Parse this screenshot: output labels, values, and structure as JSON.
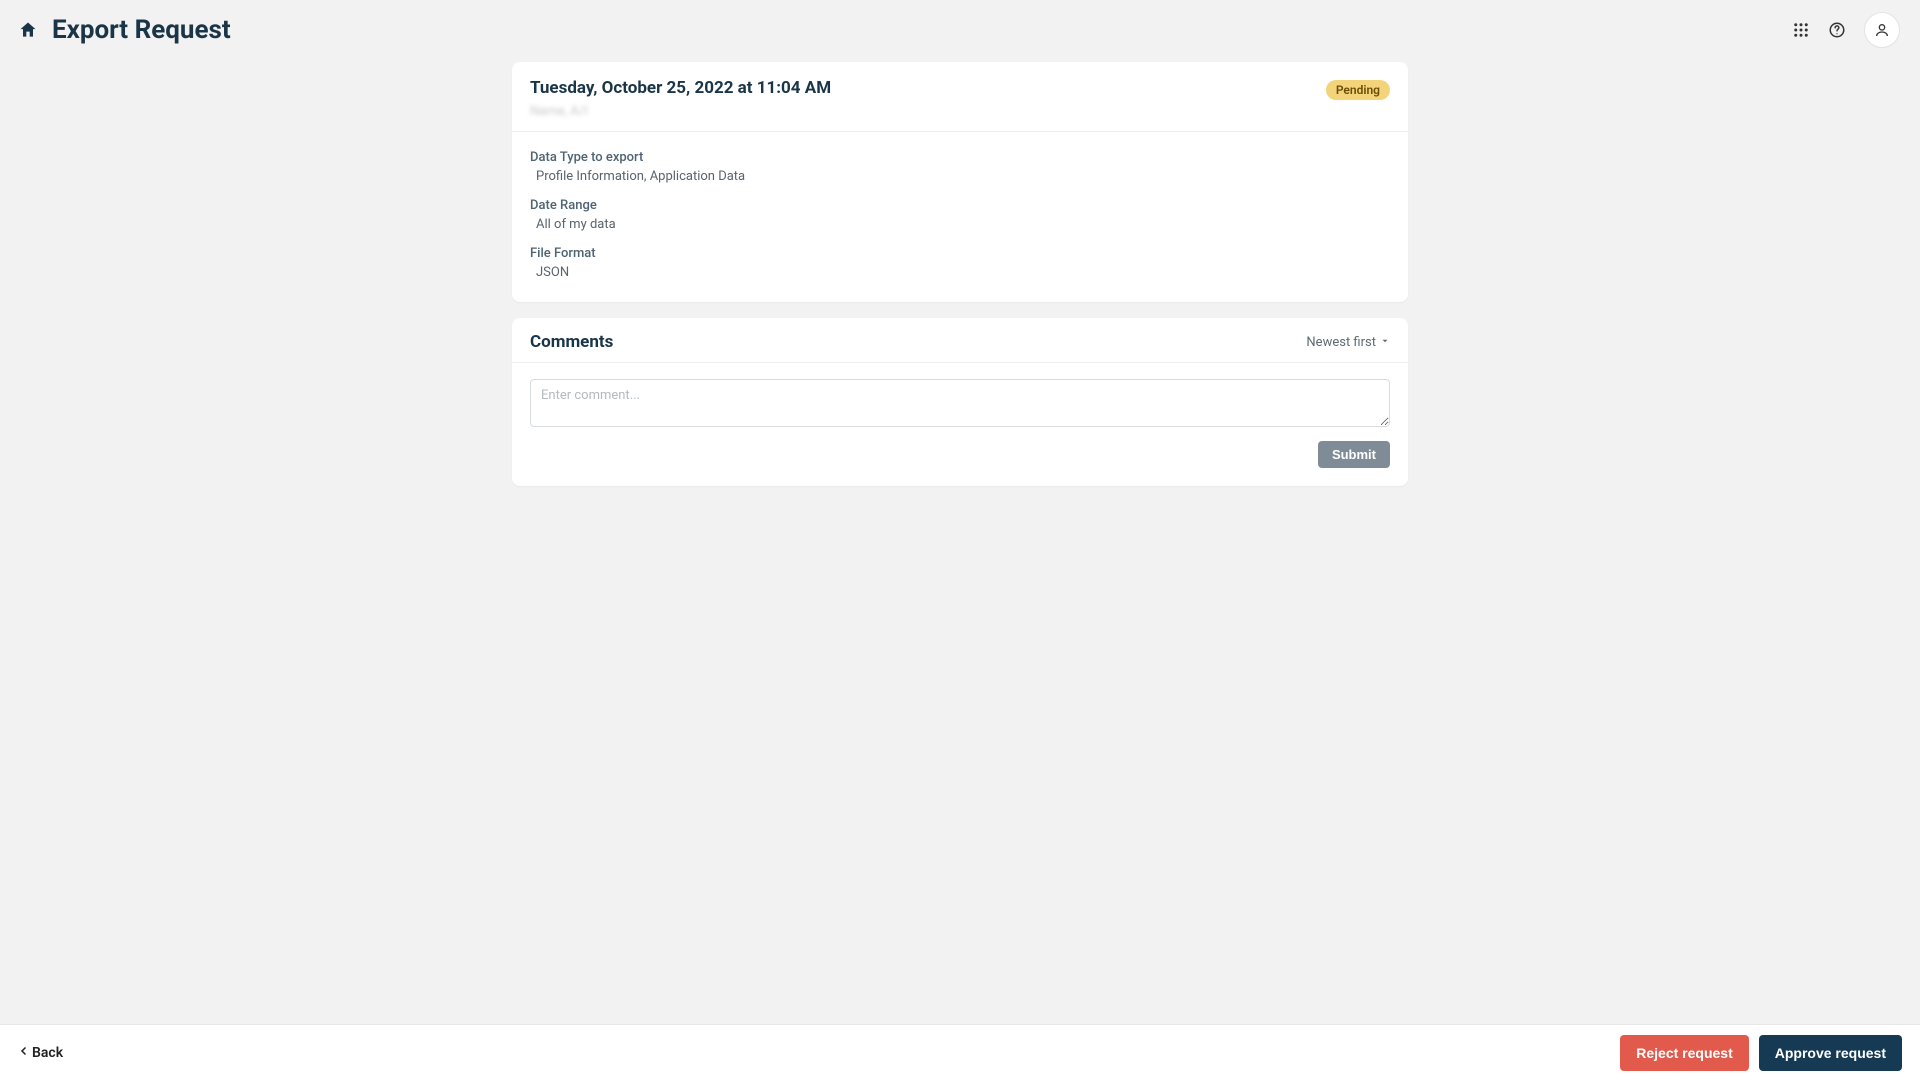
{
  "header": {
    "title": "Export Request"
  },
  "request": {
    "timestamp": "Tuesday, October 25, 2022 at 11:04 AM",
    "requester": "Name, A/I",
    "status": "Pending",
    "details": {
      "data_type_label": "Data Type to export",
      "data_type_value": "Profile Information, Application Data",
      "date_range_label": "Date Range",
      "date_range_value": "All of my data",
      "file_format_label": "File Format",
      "file_format_value": "JSON"
    }
  },
  "comments": {
    "title": "Comments",
    "sort_label": "Newest first",
    "input_placeholder": "Enter comment...",
    "submit_label": "Submit"
  },
  "footer": {
    "back_label": "Back",
    "reject_label": "Reject request",
    "approve_label": "Approve request"
  }
}
